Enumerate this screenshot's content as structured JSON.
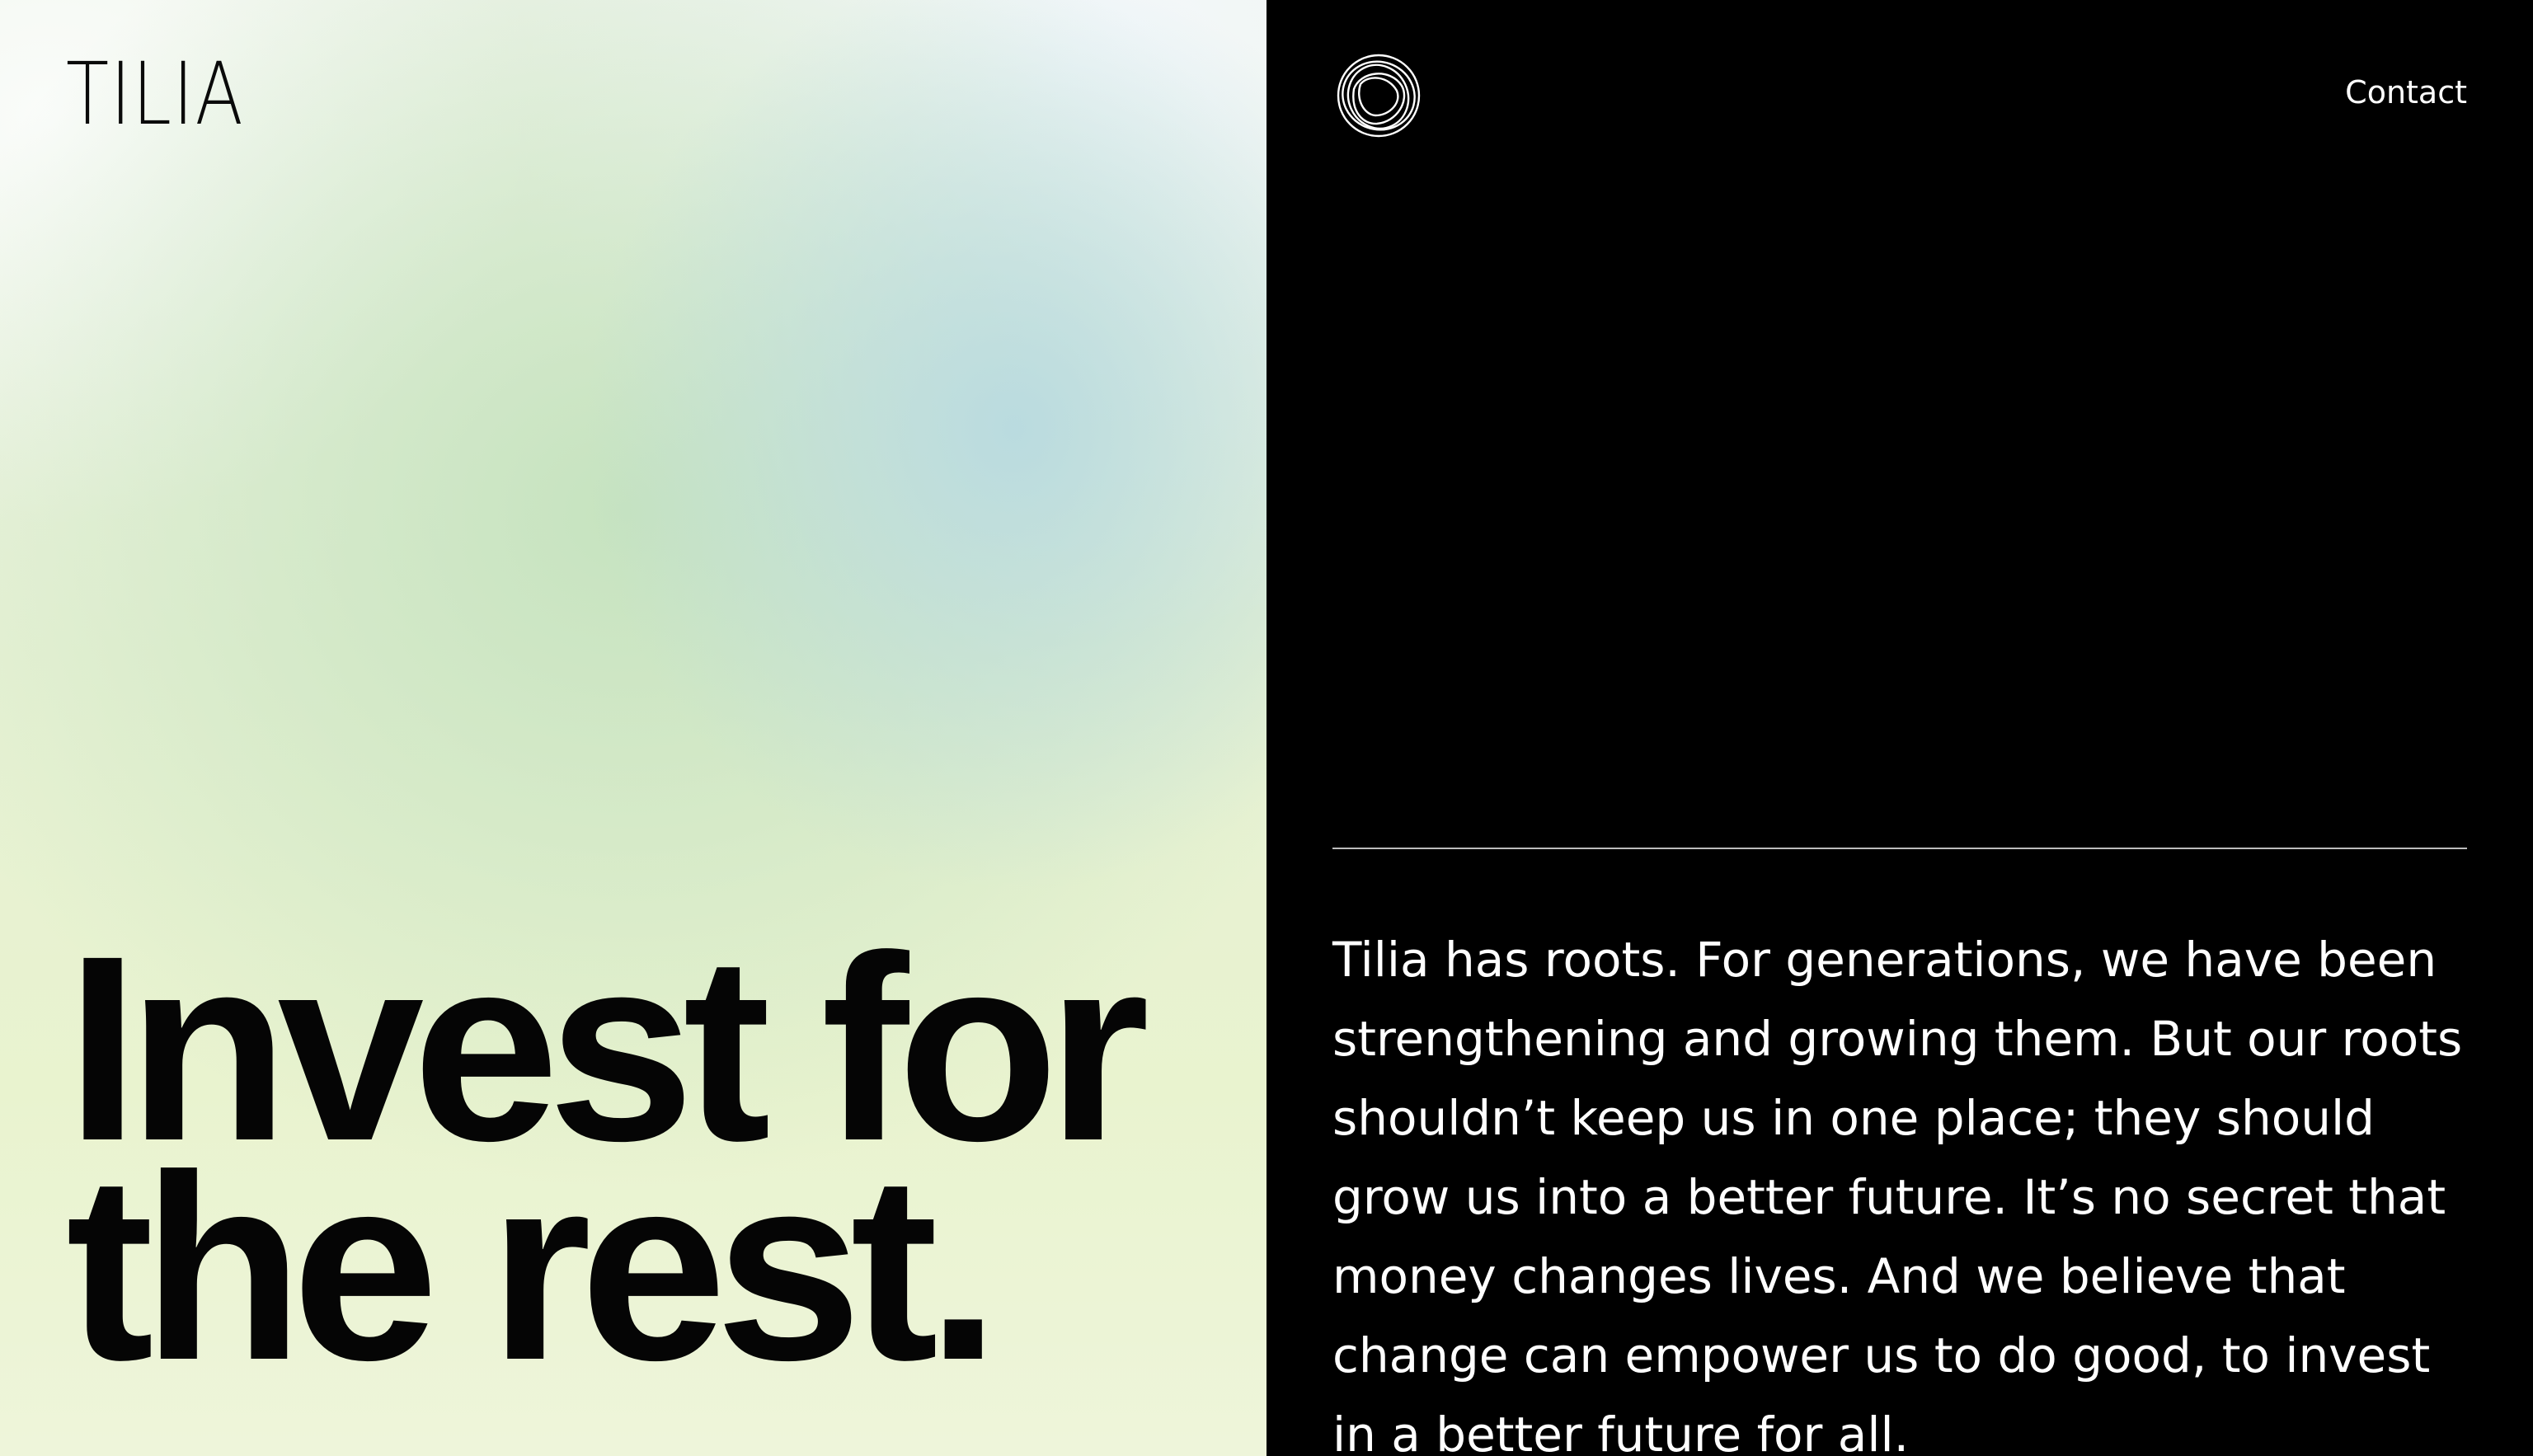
{
  "brand": {
    "wordmark": "TILIA",
    "logo_icon": "tilia-ring-logo-icon"
  },
  "nav": {
    "contact_label": "Contact"
  },
  "hero": {
    "headline_line1": "Invest for",
    "headline_line2": "the rest."
  },
  "about": {
    "paragraph": "Tilia has roots. For generations, we have been strengthening and growing them. But our roots shouldn’t keep us in one place; they should grow us into a better future. It’s no secret that money changes lives. And we believe that change can empower us to do good, to invest in a better future for all."
  },
  "colors": {
    "right_panel_bg": "#000000",
    "text_light": "#ffffff",
    "text_dark": "#050505",
    "gradient_green": "#c4e2be",
    "gradient_blue": "#b8dae0",
    "gradient_yellow": "#e9f3cf"
  }
}
